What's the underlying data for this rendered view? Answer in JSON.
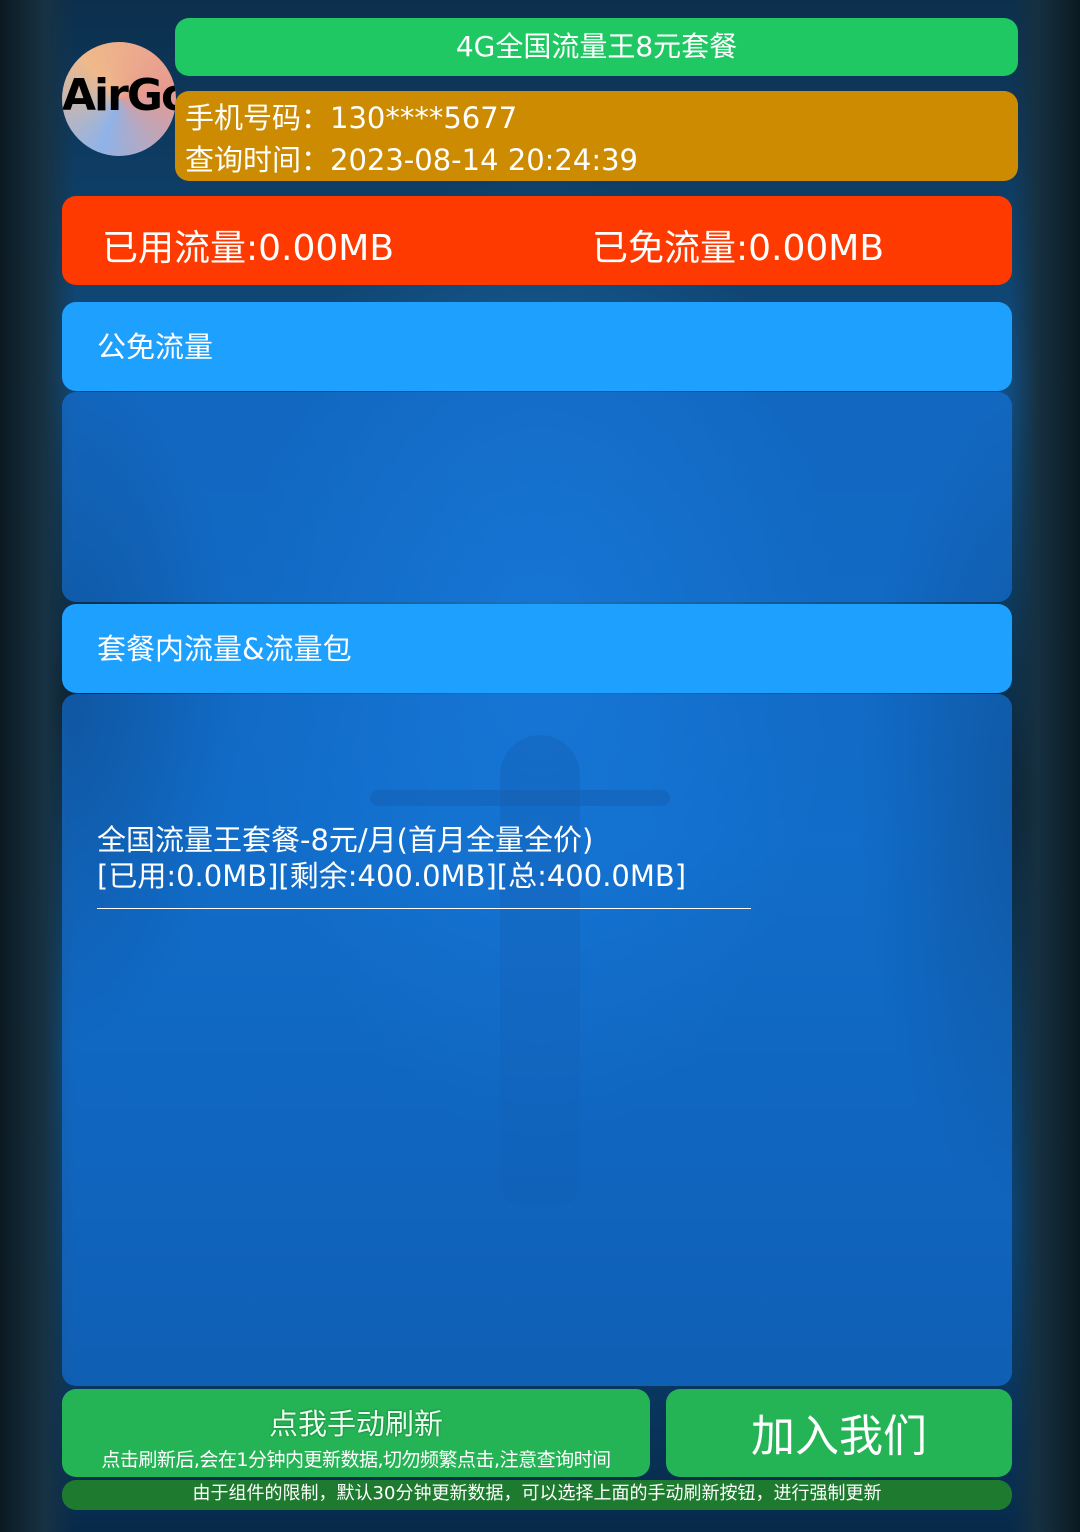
{
  "header": {
    "logo_text": "AirGo",
    "title": "4G全国流量王8元套餐"
  },
  "info": {
    "phone": "手机号码：130****5677",
    "query_time": "查询时间：2023-08-14 20:24:39"
  },
  "usage": {
    "used": "已用流量:0.00MB",
    "free": "已免流量:0.00MB"
  },
  "sections": [
    {
      "title": "公免流量"
    },
    {
      "title": "套餐内流量&流量包",
      "plan_name": "全国流量王套餐-8元/月(首月全量全价)",
      "plan_detail": "[已用:0.0MB][剩余:400.0MB][总:400.0MB]"
    }
  ],
  "actions": {
    "refresh_label": "点我手动刷新",
    "refresh_hint": "点击刷新后,会在1分钟内更新数据,切勿频繁点击,注意查询时间",
    "join_label": "加入我们"
  },
  "footer": {
    "note": "由于组件的限制，默认30分钟更新数据，可以选择上面的手动刷新按钮，进行强制更新"
  },
  "colors": {
    "title_green": "#1fc863",
    "info_orange": "#cc8b00",
    "usage_red": "#ff3a00",
    "section_blue": "#1ea0ff",
    "button_green": "#25b455"
  }
}
